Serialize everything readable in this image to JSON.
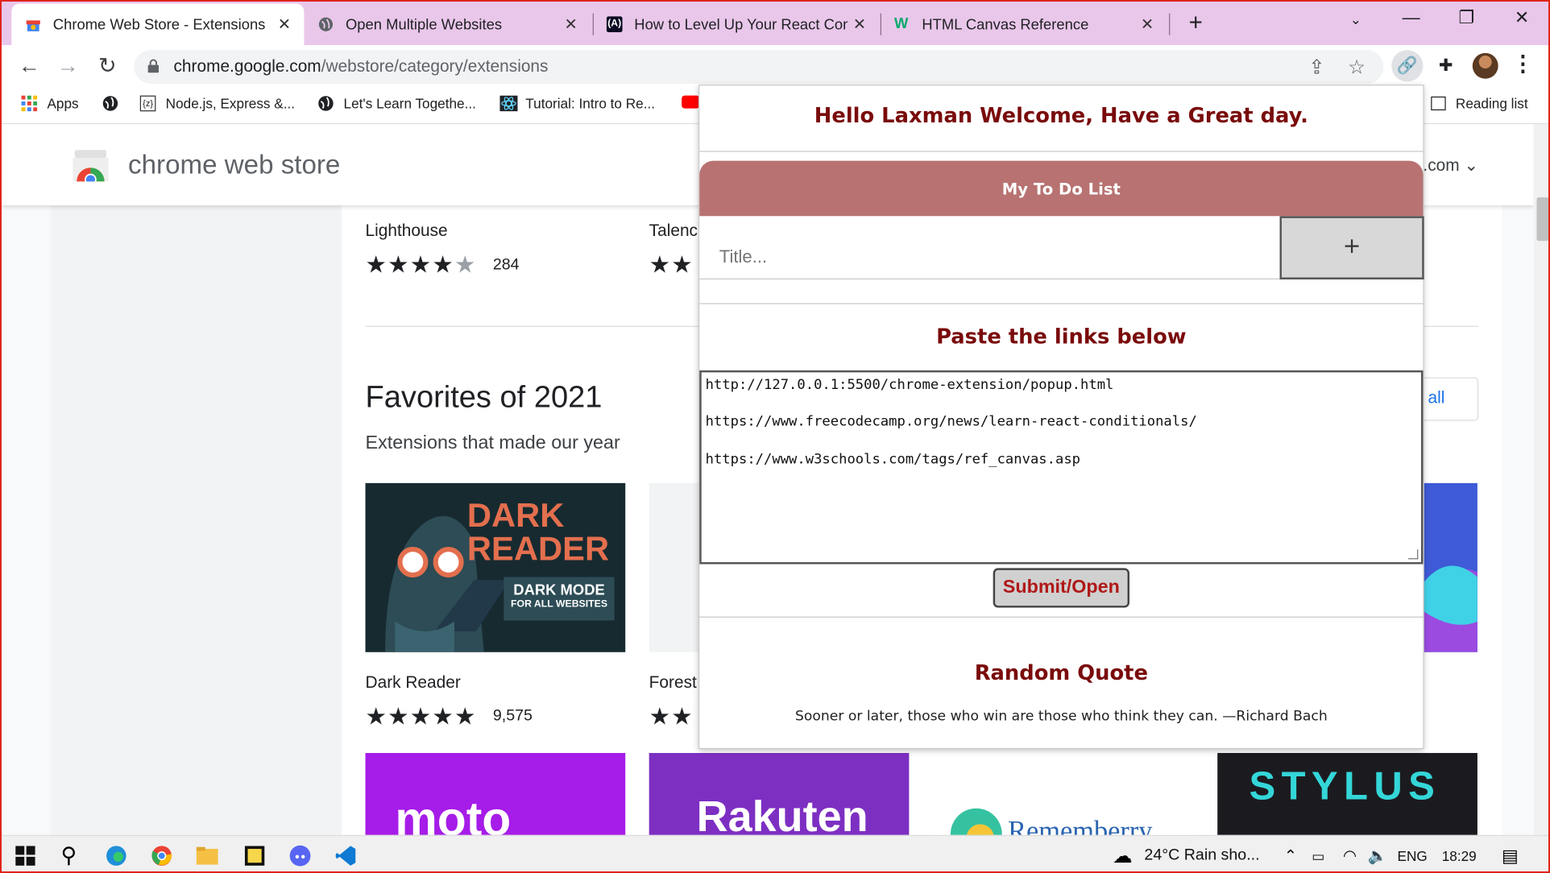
{
  "tabs": [
    {
      "title": "Chrome Web Store - Extensions",
      "active": true
    },
    {
      "title": "Open Multiple Websites"
    },
    {
      "title": "How to Level Up Your React Conditionals"
    },
    {
      "title": "HTML Canvas Reference"
    }
  ],
  "toolbar": {
    "url_host": "chrome.google.com",
    "url_path": "/webstore/category/extensions"
  },
  "bookmarks": [
    "Apps",
    "Node.js, Express &...",
    "Let's Learn Togethe...",
    "Tutorial: Intro to Re..."
  ],
  "reading_list": "Reading list",
  "store": {
    "title": "chrome web store",
    "account": ".com",
    "items_top": [
      {
        "name": "Lighthouse",
        "rating": 4.5,
        "count": "284"
      },
      {
        "name": "Talenc"
      }
    ],
    "section_title": "Favorites of 2021",
    "section_subtitle": "Extensions that made our year",
    "view_all": "all",
    "dark_reader": {
      "line1": "DARK",
      "line2": "READER",
      "badge1": "DARK MODE",
      "badge2": "FOR ALL WEBSITES"
    },
    "items_mid": [
      {
        "name": "Dark Reader",
        "rating": 5,
        "count": "9,575"
      },
      {
        "name": "Forest"
      }
    ],
    "tiles_bottom": [
      "moto",
      "Rakuten",
      "Rememberry",
      "STYLUS"
    ]
  },
  "popup": {
    "greeting": "Hello Laxman Welcome, Have a Great day.",
    "todo_header": "My To Do List",
    "todo_placeholder": "Title...",
    "add_label": "+",
    "paste_header": "Paste the links below",
    "links": "http://127.0.0.1:5500/chrome-extension/popup.html\n\nhttps://www.freecodecamp.org/news/learn-react-conditionals/\n\nhttps://www.w3schools.com/tags/ref_canvas.asp",
    "submit_label": "Submit/Open",
    "quote_header": "Random Quote",
    "quote_text": "Sooner or later, those who win are those who think they can. —Richard Bach"
  },
  "taskbar": {
    "weather": "24°C  Rain sho...",
    "lang": "ENG",
    "time": "18:29"
  },
  "colors": {
    "tabstrip": "#e9c7ea",
    "popup_heading": "#7a0b0b",
    "todo_header_bg": "#b87272",
    "submit_text": "#b01818",
    "frame_border": "#e0241b"
  }
}
